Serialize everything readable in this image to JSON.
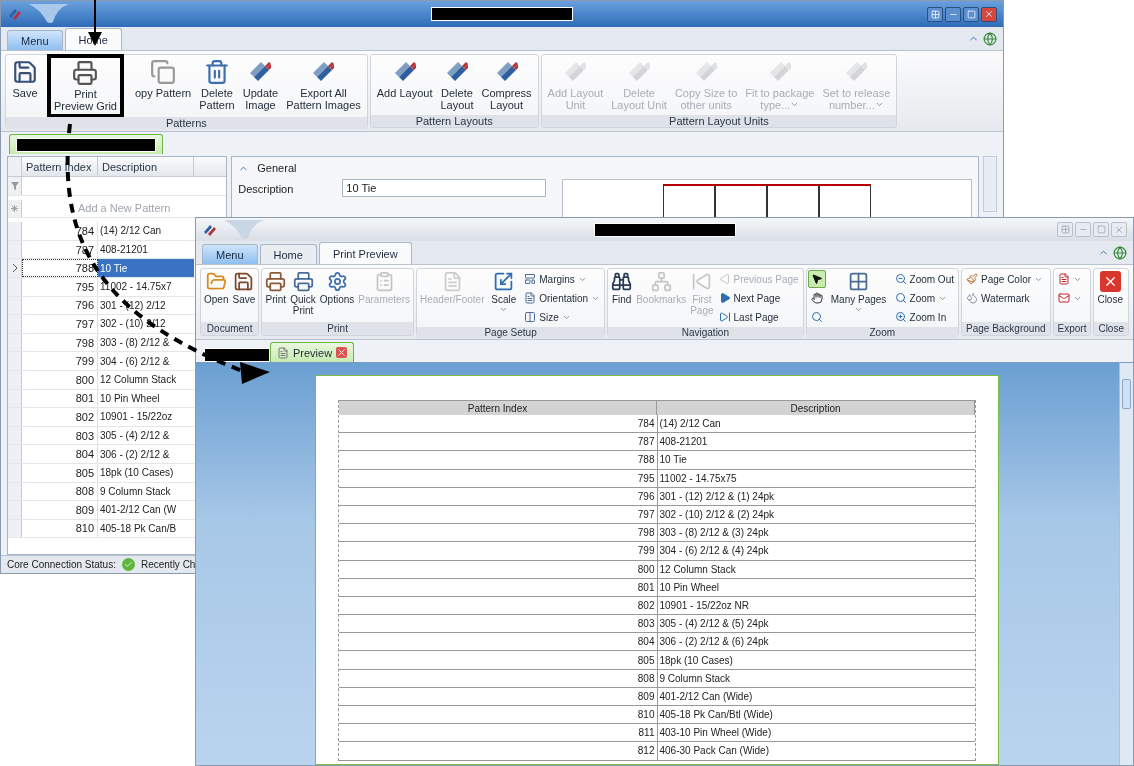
{
  "back_window": {
    "tabs": [
      {
        "label": "Menu",
        "kind": "menu",
        "selected": false
      },
      {
        "label": "Home",
        "kind": "tab",
        "selected": true
      }
    ],
    "ribbon_groups": [
      {
        "title": "Patterns",
        "buttons": [
          {
            "label": "Save",
            "kind": "large",
            "disabled": false,
            "highlighted": false
          },
          {
            "label": "Print\nPreview Grid",
            "kind": "large",
            "disabled": false,
            "highlighted": true
          },
          {
            "label": "opy Pattern",
            "kind": "large",
            "disabled": false,
            "highlighted": false
          },
          {
            "label": "Delete\nPattern",
            "kind": "large",
            "disabled": false,
            "highlighted": false
          },
          {
            "label": "Update\nImage",
            "kind": "large",
            "disabled": false,
            "highlighted": false
          },
          {
            "label": "Export All\nPattern Images",
            "kind": "large",
            "disabled": false,
            "highlighted": false
          }
        ]
      },
      {
        "title": "Pattern Layouts",
        "buttons": [
          {
            "label": "Add Layout",
            "kind": "large",
            "disabled": false,
            "highlighted": false
          },
          {
            "label": "Delete\nLayout",
            "kind": "large",
            "disabled": false,
            "highlighted": false
          },
          {
            "label": "Compress\nLayout",
            "kind": "large",
            "disabled": false,
            "highlighted": false
          }
        ]
      },
      {
        "title": "Pattern Layout Units",
        "buttons": [
          {
            "label": "Add Layout\nUnit",
            "kind": "large",
            "disabled": true,
            "highlighted": false
          },
          {
            "label": "Delete\nLayout Unit",
            "kind": "large",
            "disabled": true,
            "highlighted": false
          },
          {
            "label": "Copy Size to\nother units",
            "kind": "large",
            "disabled": true,
            "highlighted": false
          },
          {
            "label": "Fit to package\ntype...",
            "kind": "large",
            "disabled": true,
            "dropdown": true,
            "highlighted": false
          },
          {
            "label": "Set to release\nnumber...",
            "kind": "large",
            "disabled": true,
            "dropdown": true,
            "highlighted": false
          }
        ]
      }
    ],
    "grid": {
      "columns": [
        "Pattern Index",
        "Description"
      ],
      "new_row_placeholder": "Add a New Pattern",
      "rows": [
        {
          "index": "784",
          "description": "(14) 2/12 Can",
          "selected": false
        },
        {
          "index": "787",
          "description": "408-21201",
          "selected": false
        },
        {
          "index": "788",
          "description": "10 Tie",
          "selected": true
        },
        {
          "index": "795",
          "description": "11002 - 14.75x7",
          "selected": false
        },
        {
          "index": "796",
          "description": "301 - (12) 2/12",
          "selected": false
        },
        {
          "index": "797",
          "description": "302 - (10) 2/12",
          "selected": false
        },
        {
          "index": "798",
          "description": "303 - (8) 2/12 &",
          "selected": false
        },
        {
          "index": "799",
          "description": "304 - (6) 2/12 &",
          "selected": false
        },
        {
          "index": "800",
          "description": "12 Column Stack",
          "selected": false
        },
        {
          "index": "801",
          "description": "10 Pin Wheel",
          "selected": false
        },
        {
          "index": "802",
          "description": "10901 - 15/22oz",
          "selected": false
        },
        {
          "index": "803",
          "description": "305 - (4) 2/12 &",
          "selected": false
        },
        {
          "index": "804",
          "description": "306 - (2) 2/12 &",
          "selected": false
        },
        {
          "index": "805",
          "description": "18pk (10 Cases)",
          "selected": false
        },
        {
          "index": "808",
          "description": "9 Column Stack",
          "selected": false
        },
        {
          "index": "809",
          "description": "401-2/12 Can (W",
          "selected": false
        },
        {
          "index": "810",
          "description": "405-18 Pk Can/B",
          "selected": false
        }
      ]
    },
    "details": {
      "section": "General",
      "fields": [
        {
          "label": "Description",
          "value": "10 Tie"
        }
      ]
    },
    "status_bar": {
      "label": "Core Connection Status:",
      "recent": "Recently Ch"
    }
  },
  "front_window": {
    "tabs": [
      {
        "label": "Menu",
        "kind": "menu",
        "selected": false
      },
      {
        "label": "Home",
        "kind": "tab",
        "selected": false
      },
      {
        "label": "Print Preview",
        "kind": "tab",
        "selected": true
      }
    ],
    "ribbon_groups": [
      {
        "title": "Document",
        "buttons": [
          {
            "label": "Open",
            "kind": "large",
            "disabled": false
          },
          {
            "label": "Save",
            "kind": "large",
            "disabled": false
          }
        ]
      },
      {
        "title": "Print",
        "buttons": [
          {
            "label": "Print",
            "kind": "large",
            "disabled": false
          },
          {
            "label": "Quick\nPrint",
            "kind": "large",
            "disabled": false
          },
          {
            "label": "Options",
            "kind": "large",
            "disabled": false
          },
          {
            "label": "Parameters",
            "kind": "large",
            "disabled": true
          }
        ]
      },
      {
        "title": "Page Setup",
        "buttons": [
          {
            "label": "Header/Footer",
            "kind": "large",
            "disabled": true
          },
          {
            "label": "Scale",
            "kind": "large",
            "disabled": false,
            "dropdown": true
          },
          {
            "label": "Margins",
            "kind": "small",
            "disabled": false,
            "dropdown": true
          },
          {
            "label": "Orientation",
            "kind": "small",
            "disabled": false,
            "dropdown": true
          },
          {
            "label": "Size",
            "kind": "small",
            "disabled": false,
            "dropdown": true
          }
        ]
      },
      {
        "title": "Navigation",
        "buttons": [
          {
            "label": "Find",
            "kind": "large",
            "disabled": false
          },
          {
            "label": "Bookmarks",
            "kind": "large",
            "disabled": true
          },
          {
            "label": "First\nPage",
            "kind": "large",
            "disabled": true
          },
          {
            "label": "Previous Page",
            "kind": "small",
            "disabled": true
          },
          {
            "label": "Next Page",
            "kind": "small",
            "disabled": false
          },
          {
            "label": "Last Page",
            "kind": "small",
            "disabled": false
          }
        ]
      },
      {
        "title": "Zoom",
        "buttons": [
          {
            "kind": "tool",
            "disabled": false,
            "selected": true
          },
          {
            "kind": "tool",
            "disabled": false,
            "selected": false
          },
          {
            "kind": "tool",
            "disabled": false,
            "selected": false
          },
          {
            "label": "Many Pages",
            "kind": "large",
            "disabled": false,
            "dropdown": true
          },
          {
            "label": "Zoom Out",
            "kind": "small",
            "disabled": false
          },
          {
            "label": "Zoom",
            "kind": "small",
            "disabled": false,
            "dropdown": true
          },
          {
            "label": "Zoom In",
            "kind": "small",
            "disabled": false
          }
        ]
      },
      {
        "title": "Page Background",
        "buttons": [
          {
            "label": "Page Color",
            "kind": "small",
            "disabled": false,
            "dropdown": true
          },
          {
            "label": "Watermark",
            "kind": "small",
            "disabled": false
          }
        ]
      },
      {
        "title": "Export",
        "buttons": [
          {
            "kind": "icon_dropdown",
            "disabled": false,
            "dropdown": true
          },
          {
            "kind": "icon_dropdown",
            "disabled": false,
            "dropdown": true
          }
        ]
      },
      {
        "title": "Close",
        "buttons": [
          {
            "label": "Close",
            "kind": "large",
            "disabled": false
          }
        ]
      }
    ],
    "doc_tab": "Preview",
    "report": {
      "columns": [
        "Pattern Index",
        "Description"
      ],
      "rows": [
        [
          "784",
          "(14) 2/12 Can"
        ],
        [
          "787",
          "408-21201"
        ],
        [
          "788",
          "10 Tie"
        ],
        [
          "795",
          "11002 - 14.75x75"
        ],
        [
          "796",
          "301 - (12) 2/12 & (1) 24pk"
        ],
        [
          "797",
          "302 - (10) 2/12 & (2) 24pk"
        ],
        [
          "798",
          "303 - (8) 2/12 & (3) 24pk"
        ],
        [
          "799",
          "304 - (6) 2/12 & (4) 24pk"
        ],
        [
          "800",
          "12 Column Stack"
        ],
        [
          "801",
          "10 Pin Wheel"
        ],
        [
          "802",
          "10901 - 15/22oz NR"
        ],
        [
          "803",
          "305 - (4) 2/12 & (5) 24pk"
        ],
        [
          "804",
          "306 - (2) 2/12 & (6) 24pk"
        ],
        [
          "805",
          "18pk (10 Cases)"
        ],
        [
          "808",
          "9 Column Stack"
        ],
        [
          "809",
          "401-2/12 Can (Wide)"
        ],
        [
          "810",
          "405-18 Pk Can/Btl (Wide)"
        ],
        [
          "811",
          "403-10 Pin Wheel (Wide)"
        ],
        [
          "812",
          "406-30 Pack Can (Wide)"
        ]
      ]
    }
  }
}
